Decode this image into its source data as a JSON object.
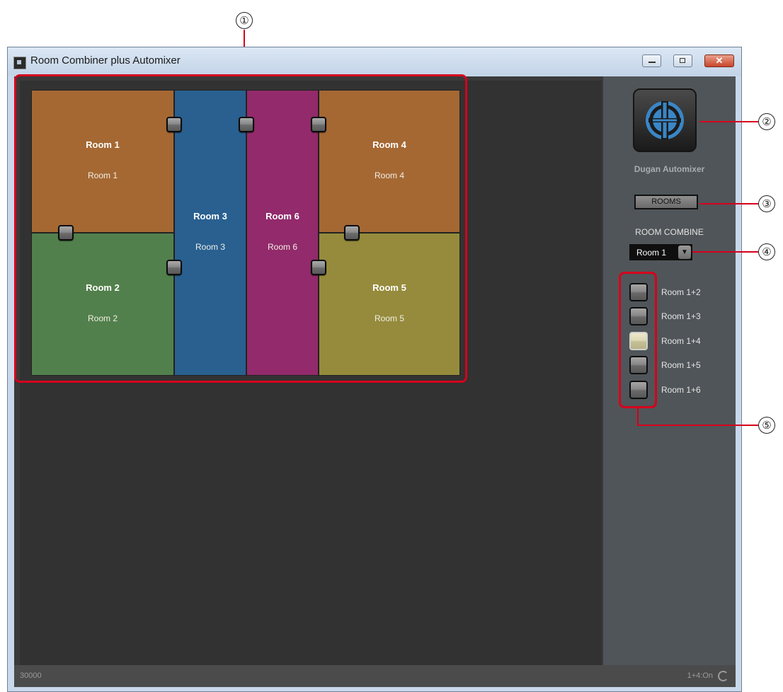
{
  "window": {
    "title": "Room Combiner plus Automixer"
  },
  "rooms": [
    {
      "title": "Room 1",
      "name": "Room 1",
      "color": "#a56833"
    },
    {
      "title": "Room 2",
      "name": "Room 2",
      "color": "#52804c"
    },
    {
      "title": "Room 3",
      "name": "Room 3",
      "color": "#296090"
    },
    {
      "title": "Room 6",
      "name": "Room 6",
      "color": "#922a6b"
    },
    {
      "title": "Room 4",
      "name": "Room 4",
      "color": "#a56833"
    },
    {
      "title": "Room 5",
      "name": "Room 5",
      "color": "#968b3c"
    }
  ],
  "panel": {
    "logo_label": "Dugan Automixer",
    "rooms_button": "ROOMS",
    "combine_label": "ROOM COMBINE",
    "combine_select": "Room 1",
    "combinations": [
      {
        "label": "Room 1+2",
        "on": false
      },
      {
        "label": "Room 1+3",
        "on": false
      },
      {
        "label": "Room 1+4",
        "on": true
      },
      {
        "label": "Room 1+5",
        "on": false
      },
      {
        "label": "Room 1+6",
        "on": false
      }
    ]
  },
  "status": {
    "left": "30000",
    "right": "1+4:On"
  },
  "callouts": [
    "①",
    "②",
    "③",
    "④",
    "⑤"
  ],
  "icons": {
    "app": "app-icon",
    "logo": "dugan-logo-icon",
    "refresh": "refresh-icon",
    "dropdown": "dropdown-arrow-icon"
  },
  "accent": "#d6001c"
}
